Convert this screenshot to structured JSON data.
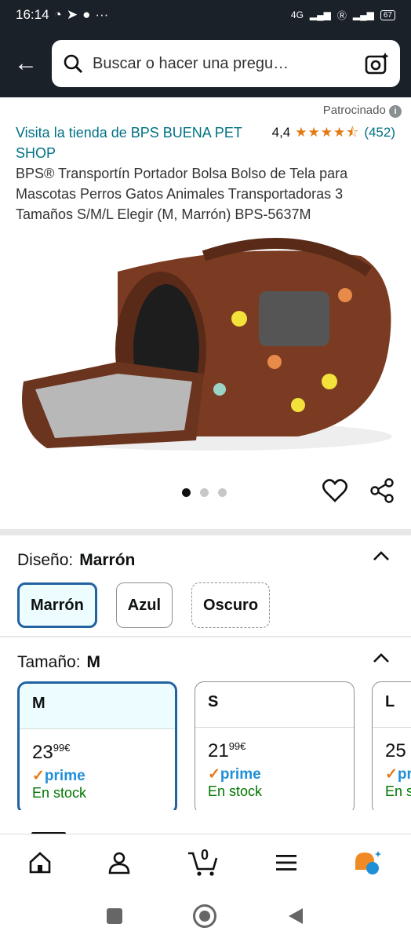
{
  "status": {
    "time": "16:14",
    "network": "4G"
  },
  "search": {
    "placeholder": "Buscar o hacer una pregu…"
  },
  "sponsored": "Patrocinado",
  "store": {
    "link": "Visita la tienda de BPS BUENA PET SHOP",
    "rating": "4,4",
    "count": "(452)"
  },
  "product": {
    "title": "BPS® Transportín Portador Bolsa Bolso de Tela para Mascotas Perros Gatos Animales Transportadoras 3 Tamaños S/M/L Elegir (M, Marrón) BPS-5637M"
  },
  "design": {
    "label": "Diseño:",
    "value": "Marrón",
    "options": [
      "Marrón",
      "Azul",
      "Oscuro"
    ]
  },
  "size": {
    "label": "Tamaño:",
    "value": "M",
    "options": [
      {
        "name": "M",
        "whole": "23",
        "frac": "99",
        "cur": "€",
        "prime": "prime",
        "stock": "En stock"
      },
      {
        "name": "S",
        "whole": "21",
        "frac": "99",
        "cur": "€",
        "prime": "prime",
        "stock": "En stock"
      },
      {
        "name": "L",
        "whole": "25",
        "frac": "",
        "cur": "",
        "prime": "pri",
        "stock": "En s"
      }
    ]
  },
  "cart": {
    "count": "0"
  },
  "colors": {
    "accent": "#2162a1",
    "link": "#007185",
    "star": "#e47911"
  }
}
